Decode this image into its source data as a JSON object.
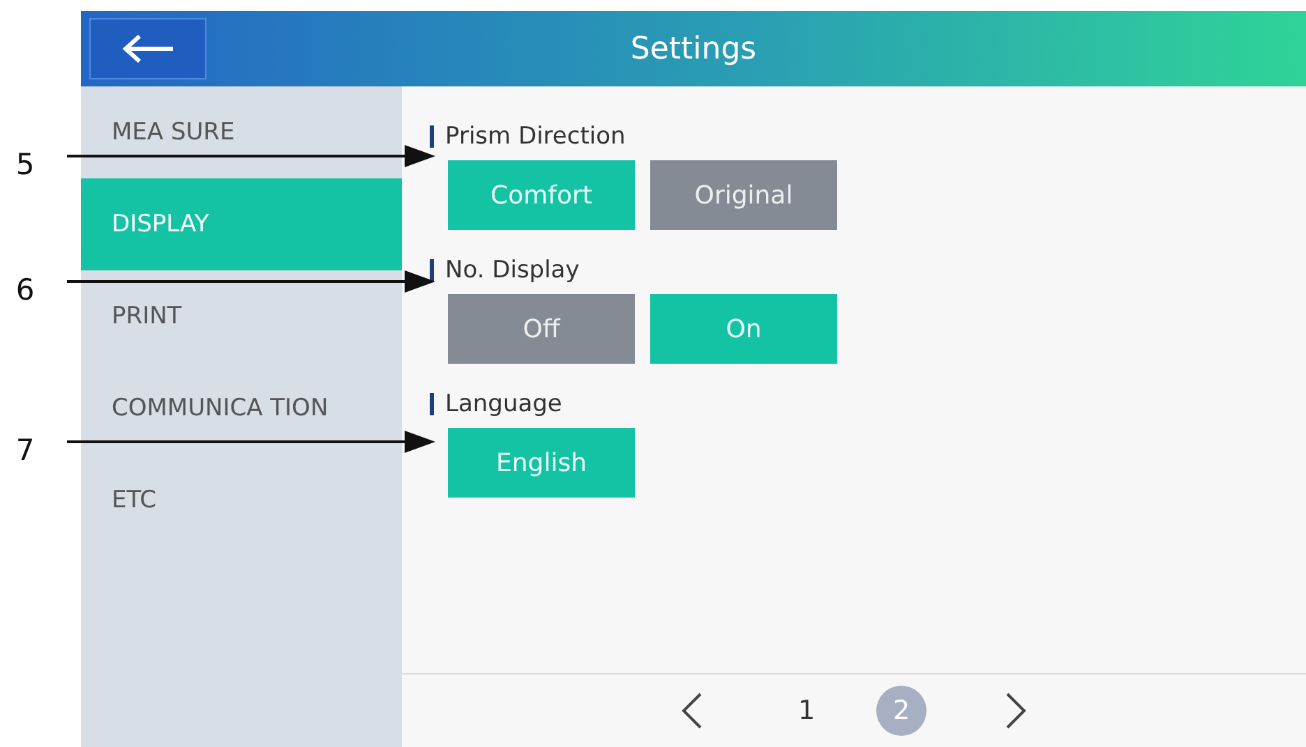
{
  "header": {
    "title": "Settings"
  },
  "sidebar": {
    "items": [
      {
        "label": "MEA SURE",
        "selected": false
      },
      {
        "label": "DISPLAY",
        "selected": true
      },
      {
        "label": "PRINT",
        "selected": false
      },
      {
        "label": "COMMUNICA TION",
        "selected": false
      },
      {
        "label": "ETC",
        "selected": false
      }
    ]
  },
  "sections": [
    {
      "title": "Prism Direction",
      "options": [
        {
          "label": "Comfort",
          "selected": true
        },
        {
          "label": "Original",
          "selected": false
        }
      ]
    },
    {
      "title": "No. Display",
      "options": [
        {
          "label": "Off",
          "selected": false
        },
        {
          "label": "On",
          "selected": true
        }
      ]
    },
    {
      "title": "Language",
      "options": [
        {
          "label": "English",
          "selected": true
        }
      ]
    }
  ],
  "pagination": {
    "pages": [
      {
        "label": "1",
        "selected": false
      },
      {
        "label": "2",
        "selected": true
      }
    ]
  },
  "callouts": [
    {
      "label": "5"
    },
    {
      "label": "6"
    },
    {
      "label": "7"
    }
  ]
}
